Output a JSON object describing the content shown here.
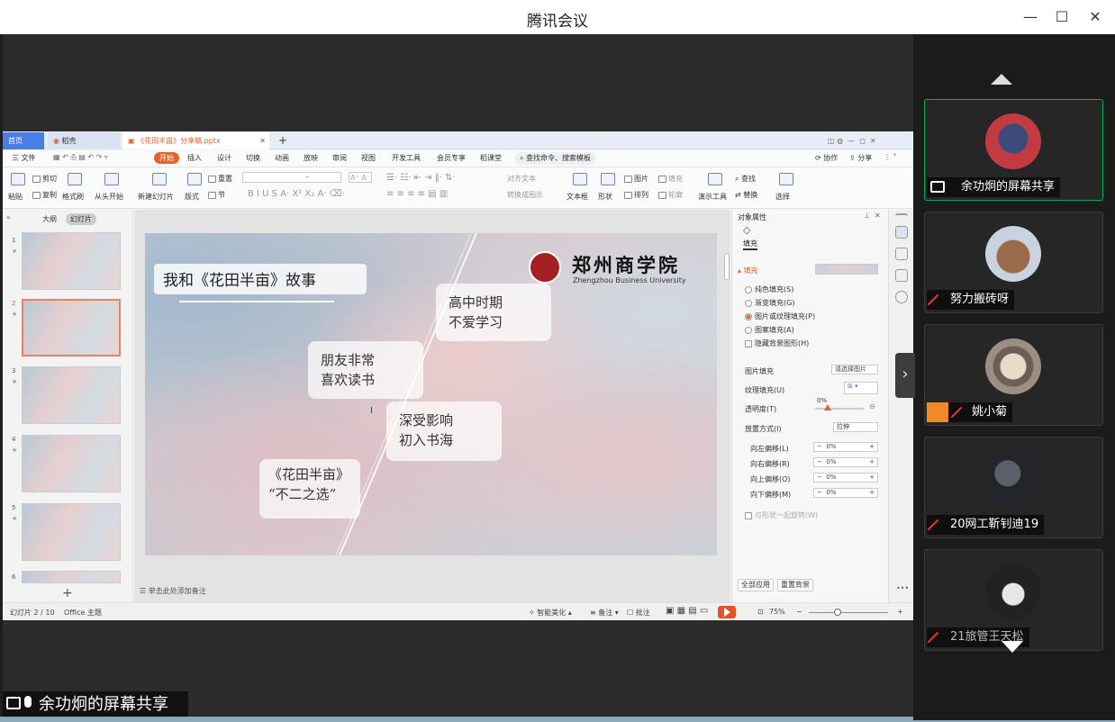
{
  "app": {
    "title": "腾讯会议",
    "minimize": "—",
    "maximize": "☐",
    "close": "✕"
  },
  "wps": {
    "tabs": {
      "home": "首页",
      "daoke": "稻壳",
      "file": "《花田半亩》分享稿.pptx",
      "add": "+"
    },
    "menu": {
      "file": "三 文件",
      "start": "开始",
      "insert": "插入",
      "design": "设计",
      "switch": "切换",
      "animation": "动画",
      "slideshow": "放映",
      "review": "审阅",
      "view": "视图",
      "dev": "开发工具",
      "member": "会员专享",
      "course": "稻课堂",
      "search": "查找命令、搜索模板",
      "collab": "协作",
      "share": "分享"
    },
    "ribbon": {
      "paste": "粘贴",
      "cut": "剪切",
      "copy": "复制",
      "format_painter": "格式刷",
      "from_start": "从头开始",
      "new_slide": "新建幻灯片",
      "layout": "版式",
      "section": "节",
      "reset": "重置",
      "font_placeholder": "-",
      "textbox": "文本框",
      "shape": "形状",
      "picture": "图片",
      "fill": "填充",
      "arrange": "排列",
      "outline": "轮廓",
      "presenter": "演示工具",
      "find": "查找",
      "replace": "替换",
      "select": "选择",
      "align_text": "对齐文本",
      "convert_smart": "转换成图示"
    },
    "left_panel": {
      "outline": "大纲",
      "slides": "幻灯片",
      "add": "+"
    },
    "thumbs": [
      {
        "num": "1",
        "star": "★"
      },
      {
        "num": "2",
        "star": "★"
      },
      {
        "num": "3",
        "star": "★"
      },
      {
        "num": "4",
        "star": "★"
      },
      {
        "num": "5",
        "star": "★"
      },
      {
        "num": "6",
        "star": ""
      }
    ],
    "slide": {
      "title": "我和《花田半亩》故事",
      "bubble1": "高中时期\n不爱学习",
      "bubble2": "朋友非常\n喜欢读书",
      "bubble3": "深受影响\n初入书海",
      "bubble4": "《花田半亩》\n“不二之选”",
      "logo_cn": "郑州商学院",
      "logo_en": "Zhengzhou Business University"
    },
    "notes": "单击此处添加备注",
    "right_pane": {
      "title": "对象属性",
      "fill_tab": "填充",
      "fill_header": "填充",
      "solid": "纯色填充(S)",
      "gradient": "渐变填充(G)",
      "picture": "图片或纹理填充(P)",
      "pattern": "图案填充(A)",
      "hide_bg": "隐藏背景图形(H)",
      "pic_fill_label": "图片填充",
      "pic_fill_value": "请选择图片",
      "texture_label": "纹理填充(U)",
      "transparency_label": "透明度(T)",
      "transparency_value": "0%",
      "placement_label": "放置方式(I)",
      "placement_value": "拉伸",
      "offset_left": "向左偏移(L)",
      "offset_right": "向右偏移(R)",
      "offset_up": "向上偏移(O)",
      "offset_down": "向下偏移(M)",
      "offset_value": "0%",
      "rotate_with": "与形状一起旋转(W)",
      "apply_all": "全部应用",
      "reset_bg": "重置背景"
    },
    "status": {
      "slide_count": "幻灯片 2 / 10",
      "theme": "Office 主题",
      "beautify": "智能美化",
      "notes": "备注",
      "comments": "批注",
      "zoom": "75%"
    }
  },
  "presenter": {
    "label": "余功炯的屏幕共享"
  },
  "participants": [
    {
      "name": "余功炯的屏幕共享",
      "active": true
    },
    {
      "name": "努力搬砖呀",
      "active": false
    },
    {
      "name": "姚小菊",
      "active": false
    },
    {
      "name": "20网工靳钊迪19",
      "active": false
    },
    {
      "name": "21旅管王天松",
      "active": false
    }
  ]
}
